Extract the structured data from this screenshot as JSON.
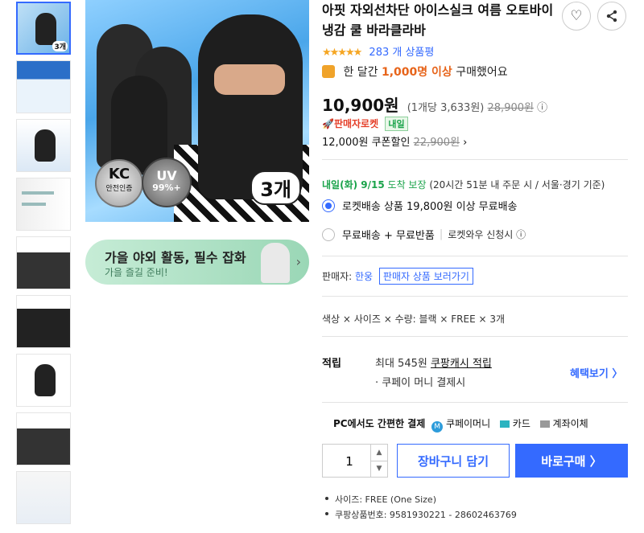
{
  "thumbnails": [
    {
      "badge": "3개",
      "selected": true
    },
    {
      "badge": "",
      "selected": false
    },
    {
      "badge": "",
      "selected": false
    },
    {
      "badge": "",
      "selected": false
    },
    {
      "badge": "",
      "selected": false
    },
    {
      "badge": "",
      "selected": false
    },
    {
      "badge": "",
      "selected": false
    },
    {
      "badge": "",
      "selected": false
    },
    {
      "badge": "",
      "selected": false
    }
  ],
  "main_image": {
    "kc_text": "안전인증",
    "kc_big": "KC",
    "uv_text": "UV",
    "uv_pct": "99%+",
    "count": "3개"
  },
  "banner": {
    "title": "가을 야외 활동, 필수 잡화",
    "subtitle": "가을 즐길 준비!",
    "arrow": "›"
  },
  "product": {
    "title": "아핏 자외선차단 아이스실크 여름 오토바이 냉감 쿨 바라클라바",
    "rating_stars": "★★★★★",
    "rating_count": "283 개 상품평",
    "month_prefix": "한 달간",
    "month_highlight": "1,000명 이상",
    "month_suffix": "구매했어요",
    "price": "10,900원",
    "unit_price": "(1개당 3,633원)",
    "original_price": "28,900원",
    "info_icon": "ⓘ",
    "rocket_label": "🚀판매자로켓",
    "rocket_tomorrow": "내일",
    "coupon_price": "12,000원",
    "coupon_label": "쿠폰할인",
    "coupon_old": "22,900원",
    "coupon_arrow": "›"
  },
  "delivery": {
    "date": "내일(화) 9/15",
    "guarantee": "도착 보장",
    "note": "(20시간 51분 내 주문 시 / 서울·경기 기준)"
  },
  "shipping_options": [
    {
      "label": "로켓배송 상품 19,800원 이상 무료배송",
      "selected": true,
      "extra": ""
    },
    {
      "label": "무료배송 + 무료반품",
      "selected": false,
      "extra": "로켓와우 신청시 ⓘ"
    }
  ],
  "seller": {
    "label": "판매자:",
    "name": "한웅",
    "link": "판매자 상품 보러가기"
  },
  "selected_option": "색상 × 사이즈 × 수량: 블랙 × FREE × 3개",
  "points": {
    "label": "적립",
    "line1_prefix": "최대 545원",
    "line1_link": "쿠팡캐시 적립",
    "line2": "· 쿠페이 머니 결제시",
    "benefit": "혜택보기 〉"
  },
  "payment": {
    "label": "PC에서도 간편한 결제",
    "m_icon": "M",
    "coupay": "쿠페이머니",
    "card": "카드",
    "bank": "계좌이체"
  },
  "purchase": {
    "quantity": "1",
    "up": "▲",
    "down": "▼",
    "cart_label": "장바구니 담기",
    "buy_label": "바로구매 〉"
  },
  "specs": [
    "사이즈: FREE (One Size)",
    "쿠팡상품번호: 9581930221 - 28602463769"
  ],
  "icons": {
    "heart": "♡",
    "share": "share-icon"
  },
  "colors": {
    "accent": "#346aff",
    "star": "#f5a623",
    "highlight": "#e7641a",
    "green": "#1aa34a",
    "rocket": "#e5402a"
  }
}
